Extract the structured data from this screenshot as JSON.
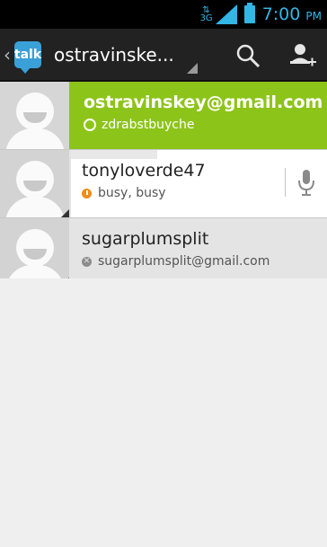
{
  "status_bar": {
    "network": "3G",
    "time": "7:00",
    "ampm": "PM"
  },
  "action_bar": {
    "app_icon_label": "talk",
    "account": "ostravinske..."
  },
  "self": {
    "email": "ostravinskey@gmail.com",
    "status": "zdrabstbuyche"
  },
  "contacts": [
    {
      "name": "tonyloverde47",
      "status": "busy, busy"
    },
    {
      "name": "sugarplumsplit",
      "status": "sugarplumsplit@gmail.com"
    }
  ],
  "colors": {
    "accent": "#33b5e5",
    "self_row": "#8dc41a",
    "busy": "#f08c1a",
    "offline": "#8c8c8c"
  },
  "icons": {
    "search": "search-icon",
    "add_friend": "add-friend-icon",
    "mic": "microphone-icon"
  }
}
